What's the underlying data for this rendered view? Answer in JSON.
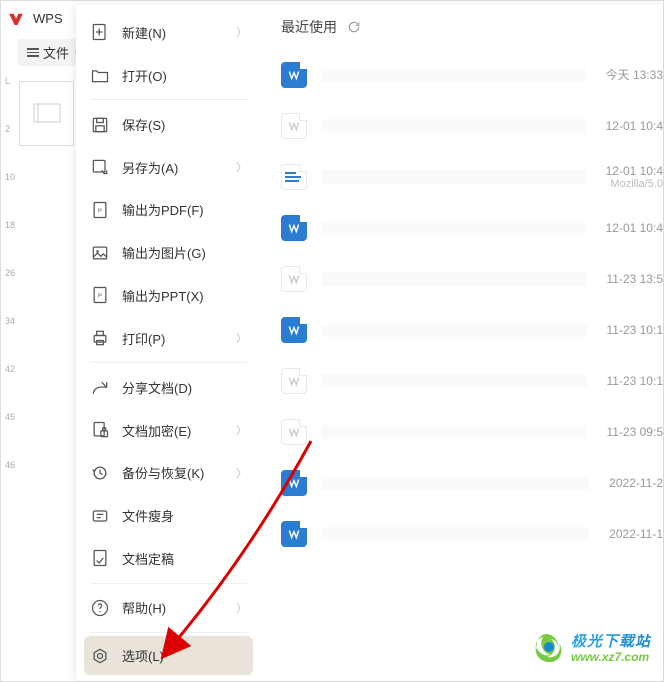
{
  "app": {
    "brand": "WPS",
    "file_button": "文件"
  },
  "menu": {
    "items": [
      {
        "label": "新建(N)",
        "icon": "new-icon",
        "chevron": true
      },
      {
        "label": "打开(O)",
        "icon": "open-icon",
        "chevron": false
      },
      {
        "label": "保存(S)",
        "icon": "save-icon",
        "chevron": false
      },
      {
        "label": "另存为(A)",
        "icon": "saveas-icon",
        "chevron": true
      },
      {
        "label": "输出为PDF(F)",
        "icon": "pdf-icon",
        "chevron": false
      },
      {
        "label": "输出为图片(G)",
        "icon": "image-icon",
        "chevron": false
      },
      {
        "label": "输出为PPT(X)",
        "icon": "ppt-icon",
        "chevron": false
      },
      {
        "label": "打印(P)",
        "icon": "print-icon",
        "chevron": true
      },
      {
        "label": "分享文档(D)",
        "icon": "share-icon",
        "chevron": false
      },
      {
        "label": "文档加密(E)",
        "icon": "encrypt-icon",
        "chevron": true
      },
      {
        "label": "备份与恢复(K)",
        "icon": "backup-icon",
        "chevron": true
      },
      {
        "label": "文件瘦身",
        "icon": "shrink-icon",
        "chevron": false
      },
      {
        "label": "文档定稿",
        "icon": "finalize-icon",
        "chevron": false
      },
      {
        "label": "帮助(H)",
        "icon": "help-icon",
        "chevron": true
      },
      {
        "label": "选项(L)",
        "icon": "options-icon",
        "chevron": false,
        "selected": true
      }
    ]
  },
  "recent": {
    "title": "最近使用",
    "files": [
      {
        "kind": "blue",
        "date": "今天  13:33"
      },
      {
        "kind": "gray",
        "date": "12-01 10:4"
      },
      {
        "kind": "html",
        "date": "12-01 10:4",
        "sub": "Mozilla/5.0"
      },
      {
        "kind": "blue",
        "date": "12-01 10:4"
      },
      {
        "kind": "gray",
        "date": "11-23 13:5"
      },
      {
        "kind": "blue",
        "date": "11-23 10:1"
      },
      {
        "kind": "gray",
        "date": "11-23 10:1"
      },
      {
        "kind": "gray",
        "date": "11-23 09:5"
      },
      {
        "kind": "blue",
        "date": "2022-11-2"
      },
      {
        "kind": "blue",
        "date": "2022-11-1"
      }
    ]
  },
  "ruler": [
    "L",
    "2",
    "10",
    "18",
    "26",
    "34",
    "42",
    "45",
    "46"
  ],
  "watermark": {
    "cn": "极光下载站",
    "url": "www.xz7.com"
  }
}
